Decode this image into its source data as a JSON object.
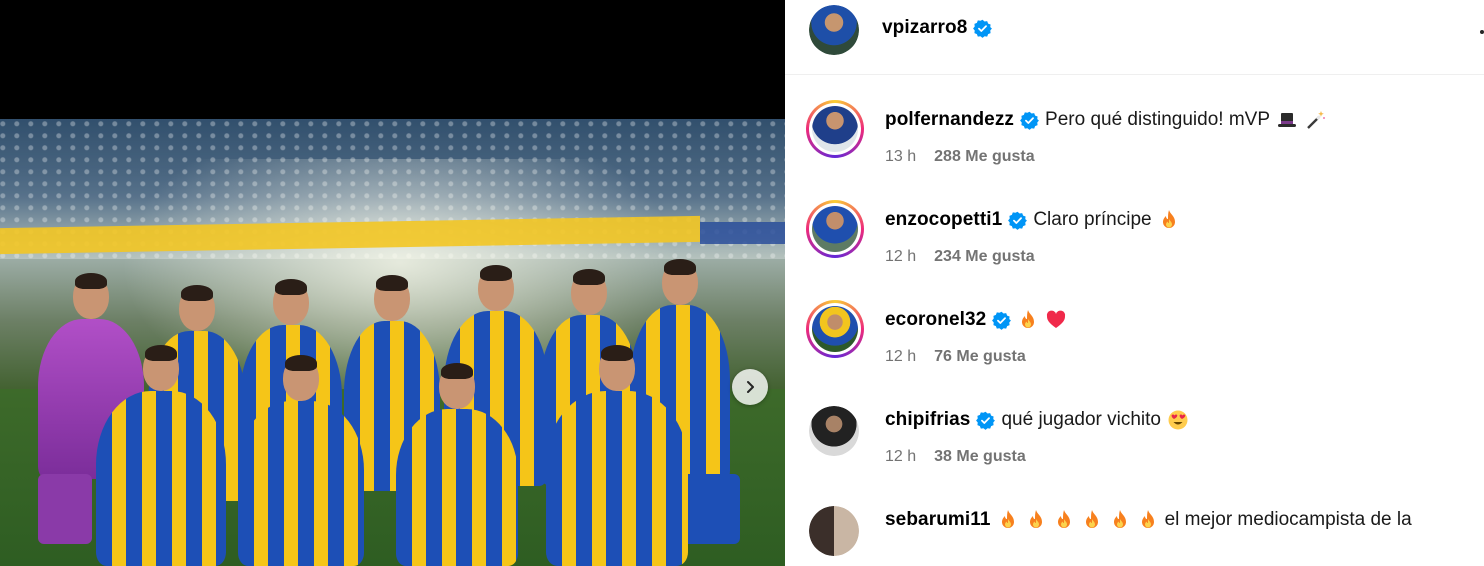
{
  "post": {
    "author": "vpizarro8",
    "verified": true
  },
  "colors": {
    "verified_blue": "#0095f6",
    "meta_grey": "#737373",
    "story_ring": [
      "#f9ce34",
      "#ee2a7b",
      "#6228d7"
    ]
  },
  "comments": [
    {
      "user": "polfernandezz",
      "text": "Pero qué distinguido! mVP",
      "emojis": [
        "top-hat-emoji",
        "magic-wand-emoji"
      ],
      "time": "13 h",
      "likes": "288 Me gusta",
      "story_ring": true
    },
    {
      "user": "enzocopetti1",
      "text": "Claro príncipe",
      "emojis": [
        "fire-emoji"
      ],
      "time": "12 h",
      "likes": "234 Me gusta",
      "story_ring": true
    },
    {
      "user": "ecoronel32",
      "text": "",
      "emojis": [
        "fire-emoji",
        "heart-emoji"
      ],
      "time": "12 h",
      "likes": "76 Me gusta",
      "story_ring": true
    },
    {
      "user": "chipifrias",
      "text": "qué jugador vichito",
      "emojis": [
        "heart-eyes-emoji"
      ],
      "time": "12 h",
      "likes": "38 Me gusta",
      "story_ring": false
    },
    {
      "user": "sebarumi11",
      "text": "el mejor mediocampista de la",
      "emojis_before_text": [
        "fire-emoji",
        "fire-emoji",
        "fire-emoji",
        "fire-emoji",
        "fire-emoji",
        "fire-emoji"
      ],
      "story_ring": false
    }
  ],
  "icons": {
    "next_button": "chevron-right-icon",
    "more": "more-options-icon"
  }
}
